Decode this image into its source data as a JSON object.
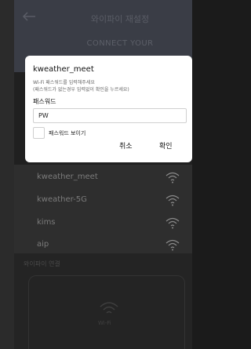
{
  "header": {
    "title": "와이파이 재설정",
    "subtitle": "CONNECT YOUR"
  },
  "dialog": {
    "ssid": "kweather_meet",
    "hint_line1": "Wi-Fi 패스워드를 입력해주세요",
    "hint_line2": "(패스워드가 없는경우 입력없이 확인을 누르세요)",
    "password_label": "패스워드",
    "password_value": "PW",
    "show_password_label": "패스워드 보이기",
    "show_password_checked": false,
    "cancel_label": "취소",
    "ok_label": "확인"
  },
  "wifi_list": [
    {
      "name": "kweather_meet",
      "icon": "wifi-icon"
    },
    {
      "name": "kweather-5G",
      "icon": "wifi-icon"
    },
    {
      "name": "kims",
      "icon": "wifi-icon"
    },
    {
      "name": "aip",
      "icon": "wifi-icon"
    }
  ],
  "section": {
    "label": "와이파이 연결",
    "icon_text": "Wi-Fi"
  },
  "colors": {
    "dialog_bg": "#ffffff",
    "overlay_bg": "#202020",
    "header_bg": "#3a3d46"
  }
}
